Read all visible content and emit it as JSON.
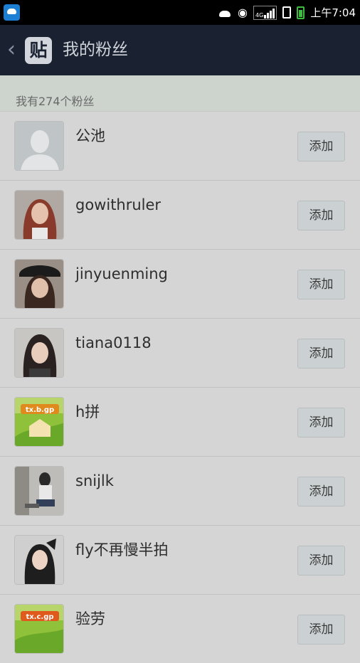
{
  "status_bar": {
    "network": "4G",
    "time": "上午7:04",
    "icons": [
      "app-icon",
      "cloud-icon",
      "wifi-icon",
      "signal-icon",
      "sim-icon",
      "battery-icon"
    ]
  },
  "header": {
    "back_icon": "chevron-left-icon",
    "logo_text": "贴",
    "title": "我的粉丝"
  },
  "summary": {
    "text": "我有274个粉丝"
  },
  "fans": [
    {
      "name": "公池",
      "button": "添加",
      "avatar": "default"
    },
    {
      "name": "gowithruler",
      "button": "添加",
      "avatar": "photo"
    },
    {
      "name": "jinyuenming",
      "button": "添加",
      "avatar": "photo"
    },
    {
      "name": "tiana0118",
      "button": "添加",
      "avatar": "photo"
    },
    {
      "name": "h拼",
      "button": "添加",
      "avatar": "graphic"
    },
    {
      "name": "snijlk",
      "button": "添加",
      "avatar": "photo"
    },
    {
      "name": "fly不再慢半拍",
      "button": "添加",
      "avatar": "photo"
    },
    {
      "name": "验劳",
      "button": "添加",
      "avatar": "graphic"
    }
  ],
  "avatar_logos": [
    "tx.b.gp",
    "tx.c.gp"
  ],
  "colors": {
    "header_bg": "#1a2232",
    "list_bg": "#d5d5d5",
    "button_bg": "#cbd0d2"
  }
}
